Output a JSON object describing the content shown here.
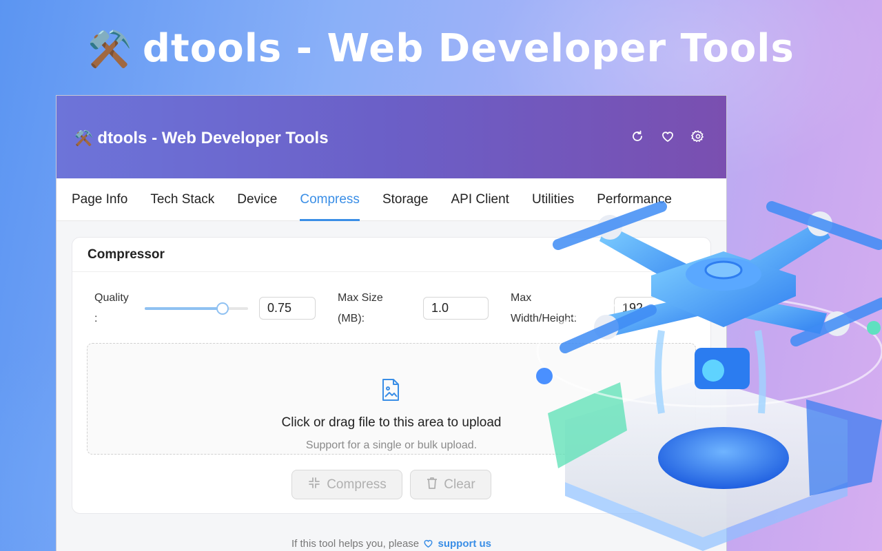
{
  "hero": {
    "emoji": "⚒️",
    "title": "dtools - Web Developer Tools"
  },
  "header": {
    "emoji": "⚒️",
    "title": "dtools - Web Developer Tools",
    "icons": [
      "refresh-icon",
      "heart-icon",
      "settings-icon"
    ]
  },
  "tabs": [
    {
      "label": "Page Info"
    },
    {
      "label": "Tech Stack"
    },
    {
      "label": "Device"
    },
    {
      "label": "Compress",
      "active": true
    },
    {
      "label": "Storage"
    },
    {
      "label": "API Client"
    },
    {
      "label": "Utilities"
    },
    {
      "label": "Performance"
    }
  ],
  "compressor": {
    "title": "Compressor",
    "quality_label_1": "Quality",
    "quality_label_2": ":",
    "quality_value": "0.75",
    "quality_slider": 0.75,
    "max_size_label_1": "Max Size",
    "max_size_label_2": "(MB):",
    "max_size_value": "1.0",
    "max_dim_label_1": "Max",
    "max_dim_label_2": "Width/Height:",
    "max_dim_value": "192",
    "upload_text": "Click or drag file to this area to upload",
    "upload_hint": "Support for a single or bulk upload.",
    "compress_button": "Compress",
    "clear_button": "Clear"
  },
  "footer": {
    "text": "If this tool helps you, please",
    "link": "support us"
  },
  "colors": {
    "accent": "#3a8ee6",
    "header_start": "#6d74d9",
    "header_end": "#7a4fb0"
  }
}
